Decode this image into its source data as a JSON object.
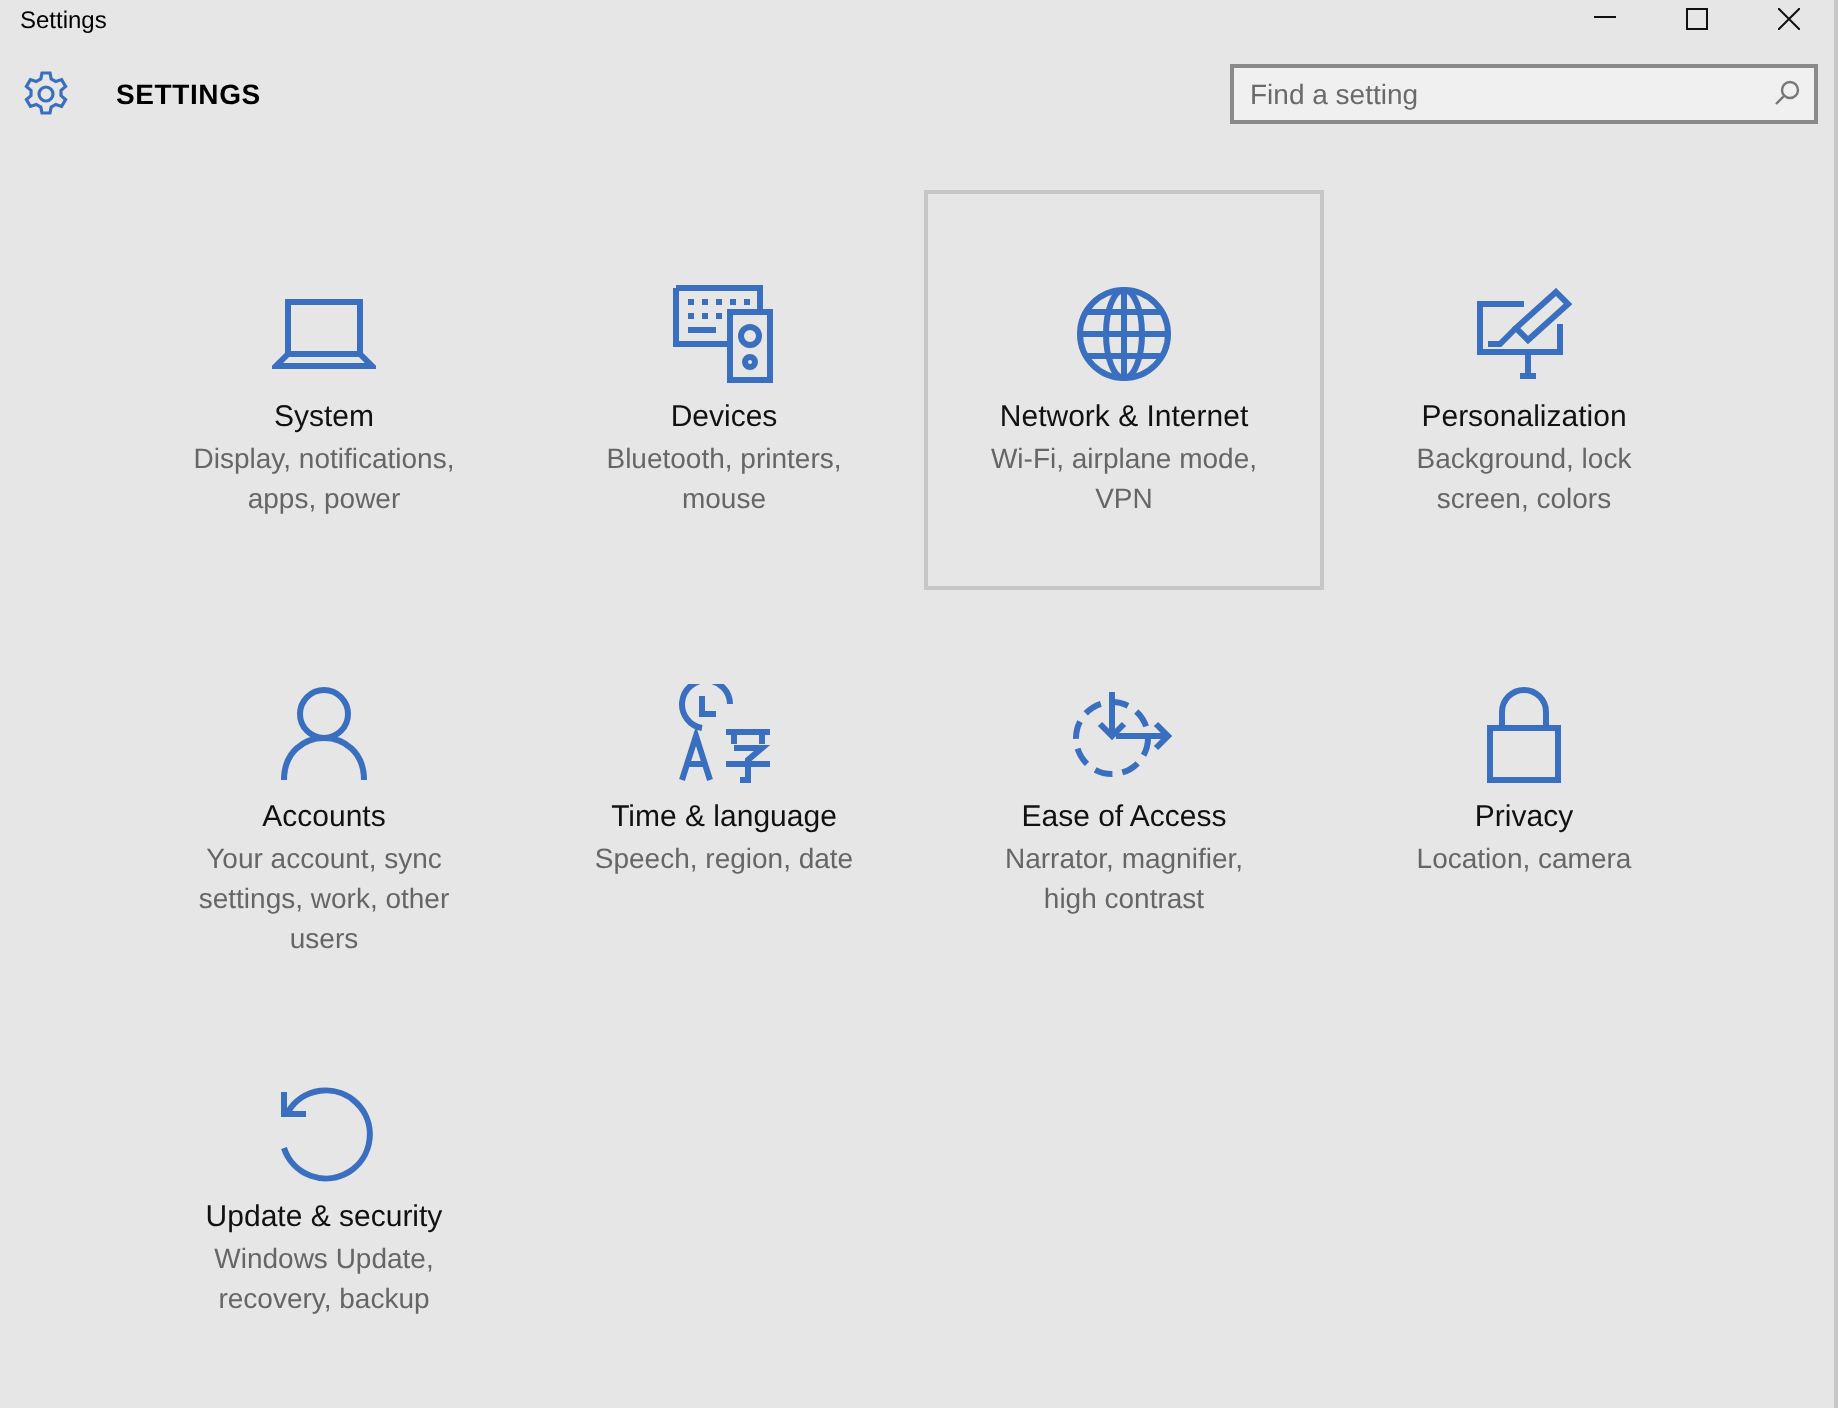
{
  "window": {
    "title": "Settings"
  },
  "header": {
    "title": "SETTINGS"
  },
  "search": {
    "placeholder": "Find a setting"
  },
  "tiles": [
    {
      "kind": "laptop",
      "title": "System",
      "description": "Display, notifications, apps, power",
      "selected": false
    },
    {
      "kind": "devices",
      "title": "Devices",
      "description": "Bluetooth, printers, mouse",
      "selected": false
    },
    {
      "kind": "globe",
      "title": "Network & Internet",
      "description": "Wi-Fi, airplane mode, VPN",
      "selected": true
    },
    {
      "kind": "paint",
      "title": "Personalization",
      "description": "Background, lock screen, colors",
      "selected": false
    },
    {
      "kind": "person",
      "title": "Accounts",
      "description": "Your account, sync settings, work, other users",
      "selected": false
    },
    {
      "kind": "time",
      "title": "Time & language",
      "description": "Speech, region, date",
      "selected": false
    },
    {
      "kind": "ease",
      "title": "Ease of Access",
      "description": "Narrator, magnifier, high contrast",
      "selected": false
    },
    {
      "kind": "lock",
      "title": "Privacy",
      "description": "Location, camera",
      "selected": false
    },
    {
      "kind": "update",
      "title": "Update & security",
      "description": "Windows Update, recovery, backup",
      "selected": false
    }
  ]
}
